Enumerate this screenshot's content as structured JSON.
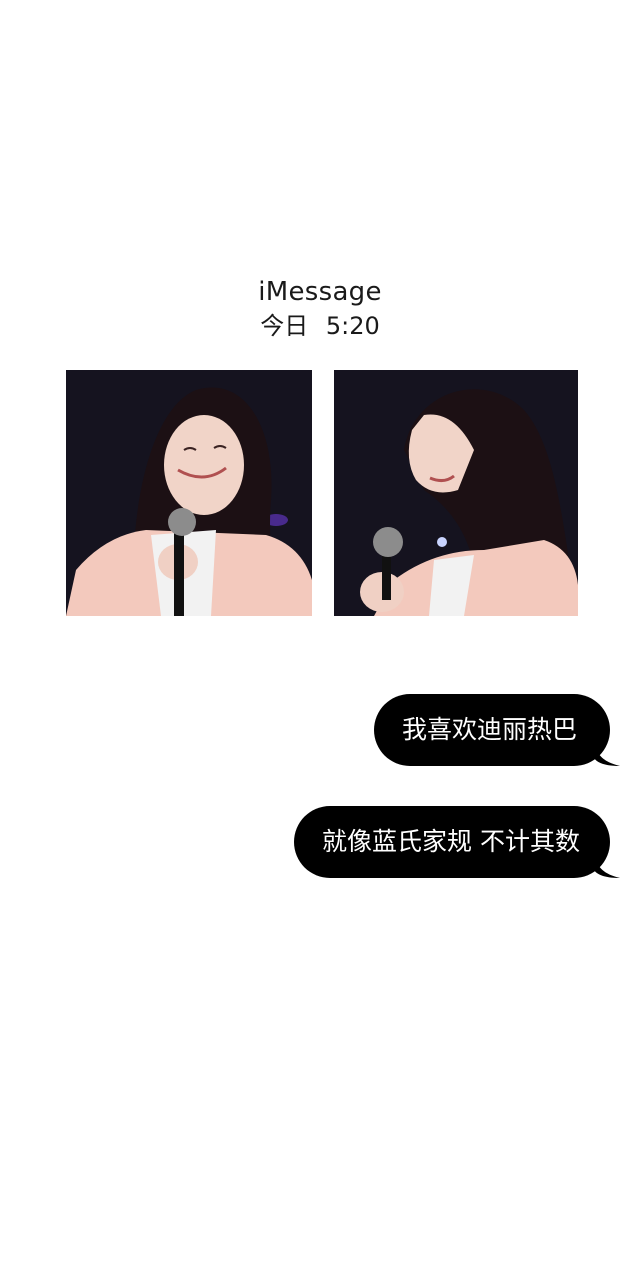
{
  "header": {
    "service": "iMessage",
    "timestamp": "今日  5:20"
  },
  "photos": [
    {
      "description_icon": "photo-performer-smiling"
    },
    {
      "description_icon": "photo-performer-profile"
    }
  ],
  "messages": [
    {
      "text": "我喜欢迪丽热巴",
      "sender": "me"
    },
    {
      "text": "就像蓝氏家规 不计其数",
      "sender": "me"
    }
  ],
  "colors": {
    "background": "#ffffff",
    "bubble": "#000000",
    "bubble_text": "#ffffff",
    "photo_bg": "#15131f"
  }
}
